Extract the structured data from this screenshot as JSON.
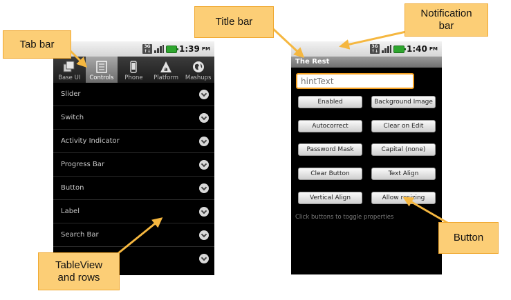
{
  "callouts": {
    "tab_bar": "Tab bar",
    "title_bar": "Title bar",
    "notification_bar": "Notification\nbar",
    "tableview": "TableView\nand rows",
    "button": "Button"
  },
  "left_phone": {
    "status": {
      "time": "1:39",
      "ampm": "PM"
    },
    "tabs": [
      {
        "label": "Base UI",
        "icon": "windows-icon"
      },
      {
        "label": "Controls",
        "icon": "list-icon",
        "active": true
      },
      {
        "label": "Phone",
        "icon": "phone-icon"
      },
      {
        "label": "Platform",
        "icon": "platform-icon"
      },
      {
        "label": "Mashups",
        "icon": "globe-icon"
      }
    ],
    "rows": [
      {
        "label": "Slider"
      },
      {
        "label": "Switch"
      },
      {
        "label": "Activity Indicator"
      },
      {
        "label": "Progress Bar"
      },
      {
        "label": "Button"
      },
      {
        "label": "Label"
      },
      {
        "label": "Search Bar"
      },
      {
        "label": ""
      }
    ]
  },
  "right_phone": {
    "status": {
      "time": "1:40",
      "ampm": "PM"
    },
    "title": "The Rest",
    "input_placeholder": "hintText",
    "buttons": [
      {
        "label": "Enabled"
      },
      {
        "label": "Background Image"
      },
      {
        "label": "Autocorrect"
      },
      {
        "label": "Clear on Edit"
      },
      {
        "label": "Password Mask"
      },
      {
        "label": "Capital (none)"
      },
      {
        "label": "Clear Button"
      },
      {
        "label": "Text Align"
      },
      {
        "label": "Vertical Align"
      },
      {
        "label": "Allow resizing"
      }
    ],
    "help_text": "Click buttons to toggle properties"
  },
  "colors": {
    "callout_fill": "#fcce76",
    "callout_border": "#f0a830",
    "arrow": "#f5b740",
    "input_focus": "#f5a020"
  }
}
